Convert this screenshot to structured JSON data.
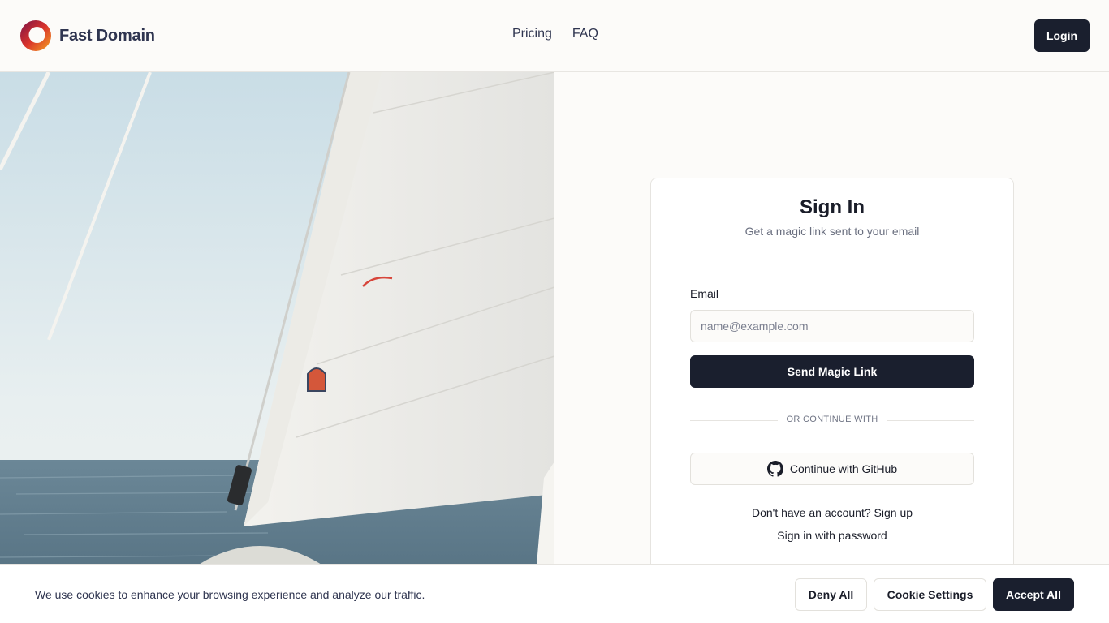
{
  "header": {
    "brand": "Fast Domain",
    "nav": [
      {
        "label": "Pricing"
      },
      {
        "label": "FAQ"
      }
    ],
    "login_label": "Login"
  },
  "hero": {
    "icon": "sailboat-photo"
  },
  "signin": {
    "title": "Sign In",
    "subtitle": "Get a magic link sent to your email",
    "email_label": "Email",
    "email_placeholder": "name@example.com",
    "email_value": "",
    "send_label": "Send Magic Link",
    "divider_text": "OR CONTINUE WITH",
    "github_label": "Continue with GitHub",
    "signup_prefix": "Don't have an account?",
    "signup_link": "Sign up",
    "password_link": "Sign in with password"
  },
  "cookie": {
    "text": "We use cookies to enhance your browsing experience and analyze our traffic.",
    "deny_label": "Deny All",
    "settings_label": "Cookie Settings",
    "accept_label": "Accept All"
  },
  "colors": {
    "primary": "#1a1f2e",
    "brand_text": "#2f3550",
    "background": "#fcfbf9"
  }
}
